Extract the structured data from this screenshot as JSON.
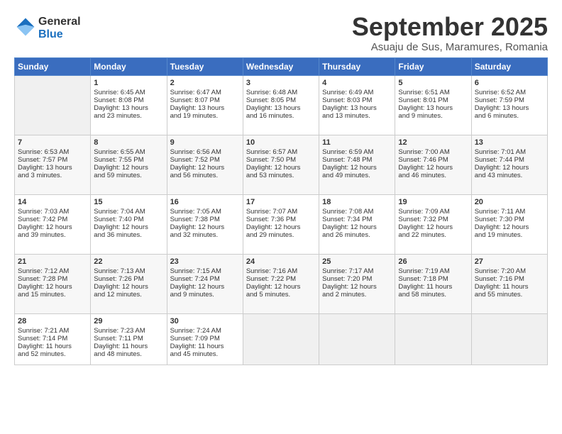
{
  "header": {
    "logo_line1": "General",
    "logo_line2": "Blue",
    "month": "September 2025",
    "location": "Asuaju de Sus, Maramures, Romania"
  },
  "days_of_week": [
    "Sunday",
    "Monday",
    "Tuesday",
    "Wednesday",
    "Thursday",
    "Friday",
    "Saturday"
  ],
  "weeks": [
    [
      {
        "day": "",
        "data": ""
      },
      {
        "day": "1",
        "data": "Sunrise: 6:45 AM\nSunset: 8:08 PM\nDaylight: 13 hours\nand 23 minutes."
      },
      {
        "day": "2",
        "data": "Sunrise: 6:47 AM\nSunset: 8:07 PM\nDaylight: 13 hours\nand 19 minutes."
      },
      {
        "day": "3",
        "data": "Sunrise: 6:48 AM\nSunset: 8:05 PM\nDaylight: 13 hours\nand 16 minutes."
      },
      {
        "day": "4",
        "data": "Sunrise: 6:49 AM\nSunset: 8:03 PM\nDaylight: 13 hours\nand 13 minutes."
      },
      {
        "day": "5",
        "data": "Sunrise: 6:51 AM\nSunset: 8:01 PM\nDaylight: 13 hours\nand 9 minutes."
      },
      {
        "day": "6",
        "data": "Sunrise: 6:52 AM\nSunset: 7:59 PM\nDaylight: 13 hours\nand 6 minutes."
      }
    ],
    [
      {
        "day": "7",
        "data": "Sunrise: 6:53 AM\nSunset: 7:57 PM\nDaylight: 13 hours\nand 3 minutes."
      },
      {
        "day": "8",
        "data": "Sunrise: 6:55 AM\nSunset: 7:55 PM\nDaylight: 12 hours\nand 59 minutes."
      },
      {
        "day": "9",
        "data": "Sunrise: 6:56 AM\nSunset: 7:52 PM\nDaylight: 12 hours\nand 56 minutes."
      },
      {
        "day": "10",
        "data": "Sunrise: 6:57 AM\nSunset: 7:50 PM\nDaylight: 12 hours\nand 53 minutes."
      },
      {
        "day": "11",
        "data": "Sunrise: 6:59 AM\nSunset: 7:48 PM\nDaylight: 12 hours\nand 49 minutes."
      },
      {
        "day": "12",
        "data": "Sunrise: 7:00 AM\nSunset: 7:46 PM\nDaylight: 12 hours\nand 46 minutes."
      },
      {
        "day": "13",
        "data": "Sunrise: 7:01 AM\nSunset: 7:44 PM\nDaylight: 12 hours\nand 43 minutes."
      }
    ],
    [
      {
        "day": "14",
        "data": "Sunrise: 7:03 AM\nSunset: 7:42 PM\nDaylight: 12 hours\nand 39 minutes."
      },
      {
        "day": "15",
        "data": "Sunrise: 7:04 AM\nSunset: 7:40 PM\nDaylight: 12 hours\nand 36 minutes."
      },
      {
        "day": "16",
        "data": "Sunrise: 7:05 AM\nSunset: 7:38 PM\nDaylight: 12 hours\nand 32 minutes."
      },
      {
        "day": "17",
        "data": "Sunrise: 7:07 AM\nSunset: 7:36 PM\nDaylight: 12 hours\nand 29 minutes."
      },
      {
        "day": "18",
        "data": "Sunrise: 7:08 AM\nSunset: 7:34 PM\nDaylight: 12 hours\nand 26 minutes."
      },
      {
        "day": "19",
        "data": "Sunrise: 7:09 AM\nSunset: 7:32 PM\nDaylight: 12 hours\nand 22 minutes."
      },
      {
        "day": "20",
        "data": "Sunrise: 7:11 AM\nSunset: 7:30 PM\nDaylight: 12 hours\nand 19 minutes."
      }
    ],
    [
      {
        "day": "21",
        "data": "Sunrise: 7:12 AM\nSunset: 7:28 PM\nDaylight: 12 hours\nand 15 minutes."
      },
      {
        "day": "22",
        "data": "Sunrise: 7:13 AM\nSunset: 7:26 PM\nDaylight: 12 hours\nand 12 minutes."
      },
      {
        "day": "23",
        "data": "Sunrise: 7:15 AM\nSunset: 7:24 PM\nDaylight: 12 hours\nand 9 minutes."
      },
      {
        "day": "24",
        "data": "Sunrise: 7:16 AM\nSunset: 7:22 PM\nDaylight: 12 hours\nand 5 minutes."
      },
      {
        "day": "25",
        "data": "Sunrise: 7:17 AM\nSunset: 7:20 PM\nDaylight: 12 hours\nand 2 minutes."
      },
      {
        "day": "26",
        "data": "Sunrise: 7:19 AM\nSunset: 7:18 PM\nDaylight: 11 hours\nand 58 minutes."
      },
      {
        "day": "27",
        "data": "Sunrise: 7:20 AM\nSunset: 7:16 PM\nDaylight: 11 hours\nand 55 minutes."
      }
    ],
    [
      {
        "day": "28",
        "data": "Sunrise: 7:21 AM\nSunset: 7:14 PM\nDaylight: 11 hours\nand 52 minutes."
      },
      {
        "day": "29",
        "data": "Sunrise: 7:23 AM\nSunset: 7:11 PM\nDaylight: 11 hours\nand 48 minutes."
      },
      {
        "day": "30",
        "data": "Sunrise: 7:24 AM\nSunset: 7:09 PM\nDaylight: 11 hours\nand 45 minutes."
      },
      {
        "day": "",
        "data": ""
      },
      {
        "day": "",
        "data": ""
      },
      {
        "day": "",
        "data": ""
      },
      {
        "day": "",
        "data": ""
      }
    ]
  ]
}
